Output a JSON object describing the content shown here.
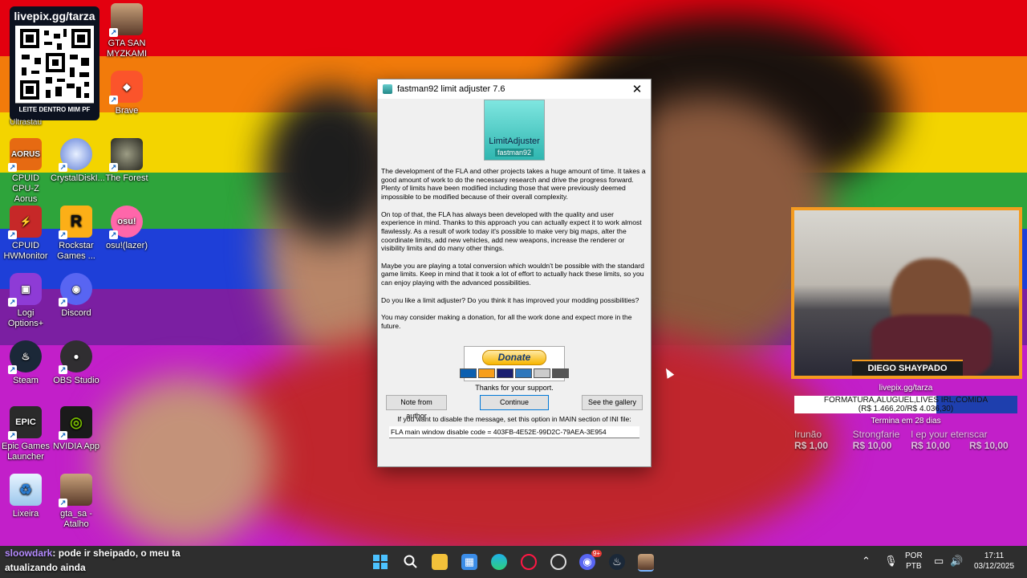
{
  "overlay_qr": {
    "url": "livepix.gg/tarza",
    "caption": "LEITE DENTRO MIM PF",
    "under": "Ultrastau"
  },
  "desktop_icons": [
    {
      "label": "GTA SAN MYZKAMI"
    },
    {
      "label": "Brave"
    },
    {
      "label": "CPUID CPU-Z Aorus"
    },
    {
      "label": "CrystalDiskI..."
    },
    {
      "label": "The Forest"
    },
    {
      "label": "CPUID HWMonitor"
    },
    {
      "label": "Rockstar Games ..."
    },
    {
      "label": "osu!(lazer)"
    },
    {
      "label": "Logi Options+"
    },
    {
      "label": "Discord"
    },
    {
      "label": "Steam"
    },
    {
      "label": "OBS Studio"
    },
    {
      "label": "Epic Games Launcher"
    },
    {
      "label": "NVIDIA App"
    },
    {
      "label": "Lixeira"
    },
    {
      "label": "gta_sa - Atalho"
    }
  ],
  "dialog": {
    "title": "fastman92 limit adjuster 7.6",
    "close": "✕",
    "logo_top": "LimitAdjuster",
    "logo_bottom": "fastman92",
    "paragraphs": [
      "The development of the FLA and other projects takes a huge amount of time. It takes a good amount of work to do the necessary research and drive the progress forward. Plenty of limits have been modified including those that were previously deemed impossible to be modified because of their overall complexity.",
      "On top of that, the FLA has always been developed with the quality and user experience in mind. Thanks to this approach you can actually expect it to work almost flawlessly. As a result of work today it's possible to make very big maps, alter the coordinate limits, add new vehicles, add new weapons, increase the renderer or visibility limits and do many other things.",
      "Maybe you are playing a total conversion which wouldn't be possible with the standard game limits. Keep in mind that it took a lot of effort to actually hack these limits, so you can enjoy playing with the advanced possibilities.",
      "Do you like a limit adjuster? Do you think it has improved your modding possibilities?",
      "You may consider making a donation, for all the work done and expect more in the future."
    ],
    "donate_label": "Donate",
    "thanks": "Thanks for your support.",
    "buttons": {
      "note": "Note from author",
      "continue": "Continue",
      "gallery": "See the gallery"
    },
    "hint": "If you want to disable the message, set this option in MAIN section of INI file:",
    "code": "FLA main window disable code = 403FB-4E52E-99D2C-79AEA-3E954"
  },
  "stream": {
    "streamer_name": "DIEGO SHAYPADO",
    "goal_url": "livepix.gg/tarza",
    "goal_title": "FORMATURA,ALUGUEL,LIVES IRL,COMIDA",
    "goal_amount": "(R$ 1.466,20/R$ 4.036,30)",
    "goal_progress": 0.363,
    "goal_ends": "Termina em 28 dias",
    "donors": [
      {
        "name": "Irunão",
        "amount": "R$ 1,00"
      },
      {
        "name": "Strongfarie",
        "amount": "R$ 10,00"
      },
      {
        "name": "l ep your eternity",
        "amount": "R$ 10,00"
      },
      {
        "name": "scar",
        "amount": "R$ 10,00"
      }
    ]
  },
  "chat": {
    "user": "sloowdark",
    "message_line1": ": pode ir sheipado, o meu ta",
    "message_line2": "atualizando ainda"
  },
  "taskbar": {
    "icons": [
      "windows-start-icon",
      "search-icon",
      "file-explorer-icon",
      "microsoft-store-icon",
      "edge-icon",
      "opera-gx-icon",
      "chrome-icon",
      "discord-icon",
      "steam-icon",
      "gta-icon"
    ],
    "discord_badge": "9+",
    "lang_top": "POR",
    "lang_bottom": "PTB",
    "time": "17:11",
    "date": "03/12/2025"
  },
  "colors": {
    "accent_orange": "#f49b1f",
    "goal_fill": "#1e3fae",
    "chat_user": "#b58bff"
  }
}
